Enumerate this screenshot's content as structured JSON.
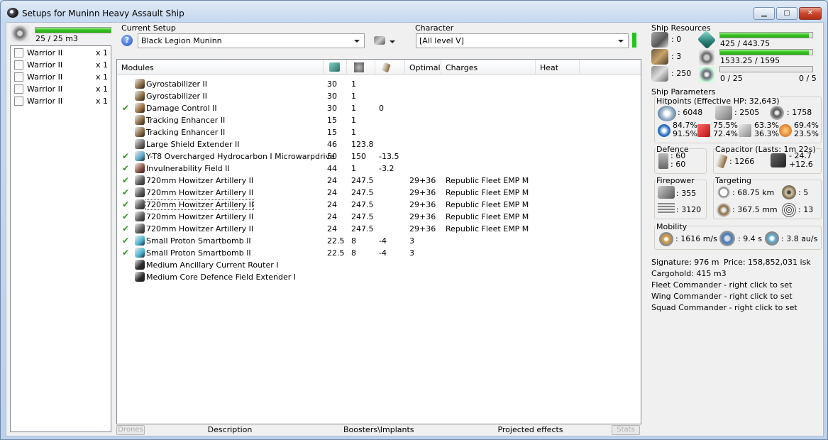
{
  "window": {
    "title": "Setups for Muninn Heavy Assault Ship"
  },
  "drone_bay": {
    "capacity": "25 / 25 m3",
    "capacity_fraction": 1.0,
    "drones": [
      {
        "name": "Warrior II",
        "qty": "x 1"
      },
      {
        "name": "Warrior II",
        "qty": "x 1"
      },
      {
        "name": "Warrior II",
        "qty": "x 1"
      },
      {
        "name": "Warrior II",
        "qty": "x 1"
      },
      {
        "name": "Warrior II",
        "qty": "x 1"
      }
    ]
  },
  "setup": {
    "label": "Current Setup",
    "value": "Black Legion Muninn"
  },
  "character": {
    "label": "Character",
    "value": "[All level V]"
  },
  "modules": {
    "headers": {
      "name": "Modules",
      "optimal": "Optimal",
      "charges": "Charges",
      "heat": "Heat"
    },
    "rows": [
      {
        "active": false,
        "icon": "gyrostabilizer-icon",
        "color": "#8a6a44",
        "name": "Gyrostabilizer II",
        "cpu": "30",
        "pg": "1",
        "cap": "",
        "optimal": "",
        "charge": ""
      },
      {
        "active": false,
        "icon": "gyrostabilizer-icon",
        "color": "#8a6a44",
        "name": "Gyrostabilizer II",
        "cpu": "30",
        "pg": "1",
        "cap": "",
        "optimal": "",
        "charge": ""
      },
      {
        "active": true,
        "icon": "damage-control-icon",
        "color": "#9a6f3c",
        "name": "Damage Control II",
        "cpu": "30",
        "pg": "1",
        "cap": "0",
        "optimal": "",
        "charge": ""
      },
      {
        "active": false,
        "icon": "tracking-enhancer-icon",
        "color": "#8a6a44",
        "name": "Tracking Enhancer II",
        "cpu": "15",
        "pg": "1",
        "cap": "",
        "optimal": "",
        "charge": ""
      },
      {
        "active": false,
        "icon": "tracking-enhancer-icon",
        "color": "#8a6a44",
        "name": "Tracking Enhancer II",
        "cpu": "15",
        "pg": "1",
        "cap": "",
        "optimal": "",
        "charge": ""
      },
      {
        "active": false,
        "icon": "shield-extender-icon",
        "color": "#6e6a66",
        "name": "Large Shield Extender II",
        "cpu": "46",
        "pg": "123.8",
        "cap": "",
        "optimal": "",
        "charge": ""
      },
      {
        "active": true,
        "icon": "microwarpdrive-icon",
        "color": "#5aa7c9",
        "name": "Y-T8 Overcharged Hydrocarbon I Microwarpdrive",
        "cpu": "50",
        "pg": "150",
        "cap": "-13.5",
        "optimal": "",
        "charge": ""
      },
      {
        "active": true,
        "icon": "invulnerability-field-icon",
        "color": "#8b4f44",
        "name": "Invulnerability Field II",
        "cpu": "44",
        "pg": "1",
        "cap": "-3.2",
        "optimal": "",
        "charge": ""
      },
      {
        "active": true,
        "icon": "artillery-icon",
        "color": "#5a5a5a",
        "name": "720mm Howitzer Artillery II",
        "cpu": "24",
        "pg": "247.5",
        "cap": "",
        "optimal": "29+36",
        "charge": "Republic Fleet EMP M"
      },
      {
        "active": true,
        "icon": "artillery-icon",
        "color": "#5a5a5a",
        "name": "720mm Howitzer Artillery II",
        "cpu": "24",
        "pg": "247.5",
        "cap": "",
        "optimal": "29+36",
        "charge": "Republic Fleet EMP M"
      },
      {
        "active": true,
        "icon": "artillery-icon",
        "color": "#5a5a5a",
        "name": "720mm Howitzer Artillery II",
        "cpu": "24",
        "pg": "247.5",
        "cap": "",
        "optimal": "29+36",
        "charge": "Republic Fleet EMP M"
      },
      {
        "active": true,
        "icon": "artillery-icon",
        "color": "#5a5a5a",
        "name": "720mm Howitzer Artillery II",
        "cpu": "24",
        "pg": "247.5",
        "cap": "",
        "optimal": "29+36",
        "charge": "Republic Fleet EMP M"
      },
      {
        "active": true,
        "icon": "artillery-icon",
        "color": "#5a5a5a",
        "name": "720mm Howitzer Artillery II",
        "cpu": "24",
        "pg": "247.5",
        "cap": "",
        "optimal": "29+36",
        "charge": "Republic Fleet EMP M"
      },
      {
        "active": true,
        "icon": "smartbomb-icon",
        "color": "#49b3d0",
        "name": "Small Proton Smartbomb II",
        "cpu": "22.5",
        "pg": "8",
        "cap": "-4",
        "optimal": "3",
        "charge": ""
      },
      {
        "active": true,
        "icon": "smartbomb-icon",
        "color": "#49b3d0",
        "name": "Small Proton Smartbomb II",
        "cpu": "22.5",
        "pg": "8",
        "cap": "-4",
        "optimal": "3",
        "charge": ""
      },
      {
        "active": false,
        "icon": "rig-icon",
        "color": "#2a2a2a",
        "name": "Medium Ancillary Current Router I",
        "cpu": "",
        "pg": "",
        "cap": "",
        "optimal": "",
        "charge": ""
      },
      {
        "active": false,
        "icon": "rig-icon",
        "color": "#2a2a2a",
        "name": "Medium Core Defence Field Extender I",
        "cpu": "",
        "pg": "",
        "cap": "",
        "optimal": "",
        "charge": ""
      }
    ]
  },
  "tabs": {
    "drones": "Drones",
    "description": "Description",
    "boosters": "Boosters\\Implants",
    "projected": "Projected effects",
    "stats": "Stats"
  },
  "resources": {
    "title": "Ship Resources",
    "turrets": ": 0",
    "launchers": ": 3",
    "calibration": ": 250",
    "cpu": "425 / 443.75",
    "cpu_fraction": 0.958,
    "powergrid": "1533.25 / 1595",
    "pg_fraction": 0.961,
    "drone_bw": "0 / 25",
    "drone_bw_fraction": 0.0,
    "drones_active": "0 / 5"
  },
  "params": {
    "title": "Ship Parameters",
    "hitpoints_title": "Hitpoints (Effective HP: 32,643)",
    "shield_hp": ": 6048",
    "armor_hp": ": 2505",
    "structure_hp": ": 1758",
    "res": [
      {
        "a": "84.7%",
        "b": "91.5%"
      },
      {
        "a": "75.5%",
        "b": "72.4%"
      },
      {
        "a": "63.3%",
        "b": "36.3%"
      },
      {
        "a": "69.4%",
        "b": "23.5%"
      }
    ],
    "defence_title": "Defence",
    "defence_a": ": 60",
    "defence_b": ": 60",
    "capacitor_title": "Capacitor (Lasts: 1m 22s)",
    "cap_amount": ": 1266",
    "cap_use": "- 24.7",
    "cap_recharge": "+12.6",
    "firepower_title": "Firepower",
    "dps": ": 355",
    "volley": ": 3120",
    "targeting_title": "Targeting",
    "range": ": 68.75 km",
    "max_targets": ": 5",
    "scan_res": ": 367.5 mm",
    "sensor": ": 13",
    "mobility_title": "Mobility",
    "speed": ": 1616 m/s",
    "align": ": 9.4 s",
    "warp": ": 3.8 au/s",
    "signature": "Signature: 976 m",
    "price": "Price: 158,852,031 isk",
    "cargo": "Cargohold: 415 m3",
    "fleet": "Fleet Commander - right click to set",
    "wing": "Wing Commander - right click to set",
    "squad": "Squad Commander - right click to set"
  }
}
